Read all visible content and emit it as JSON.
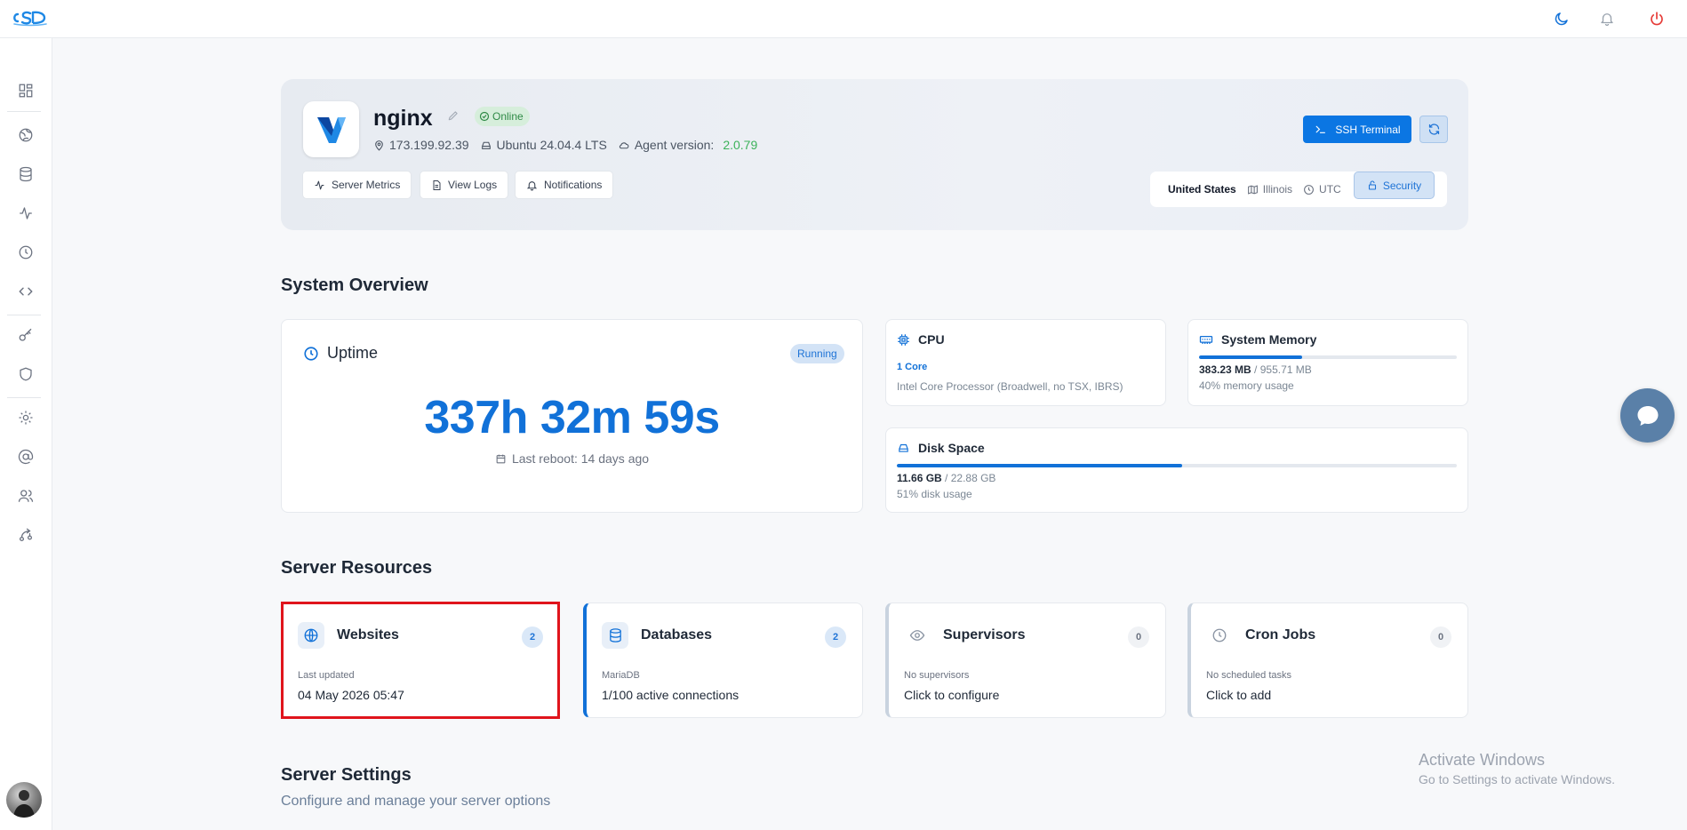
{
  "server": {
    "name": "nginx",
    "status": "Online",
    "ip": "173.199.92.39",
    "os": "Ubuntu 24.04.4 LTS",
    "agent_label": "Agent version:",
    "agent_version": "2.0.79",
    "actions": {
      "metrics": "Server Metrics",
      "logs": "View Logs",
      "notifications": "Notifications",
      "ssh": "SSH Terminal",
      "security": "Security"
    },
    "location": {
      "country": "United States",
      "region": "Illinois",
      "timezone": "UTC"
    }
  },
  "overview": {
    "title": "System Overview",
    "uptime": {
      "label": "Uptime",
      "status": "Running",
      "value": "337h 32m 59s",
      "last_reboot": "Last reboot: 14 days ago"
    },
    "cpu": {
      "label": "CPU",
      "cores": "1 Core",
      "model": "Intel Core Processor (Broadwell, no TSX, IBRS)"
    },
    "memory": {
      "label": "System Memory",
      "used": "383.23 MB",
      "total": "/ 955.71 MB",
      "usage_text": "40% memory usage",
      "usage_fraction": 0.4
    },
    "disk": {
      "label": "Disk Space",
      "used": "11.66 GB",
      "total": "/ 22.88 GB",
      "usage_text": "51% disk usage",
      "usage_fraction": 0.51
    }
  },
  "resources": {
    "title": "Server Resources",
    "items": [
      {
        "label": "Websites",
        "count": "2",
        "sub": "Last updated",
        "value": "04 May 2026 05:47"
      },
      {
        "label": "Databases",
        "count": "2",
        "sub": "MariaDB",
        "value": "1/100 active connections"
      },
      {
        "label": "Supervisors",
        "count": "0",
        "sub": "No supervisors",
        "value": "Click to configure"
      },
      {
        "label": "Cron Jobs",
        "count": "0",
        "sub": "No scheduled tasks",
        "value": "Click to add"
      }
    ]
  },
  "settings": {
    "title": "Server Settings",
    "subtitle": "Configure and manage your server options"
  },
  "watermark": {
    "line1": "Activate Windows",
    "line2": "Go to Settings to activate Windows."
  },
  "colors": {
    "accent": "#1171d8",
    "online": "#2f8a46",
    "power": "#e53935",
    "highlight": "#e0141c"
  },
  "icons": {
    "topbar": [
      "moon-icon",
      "bell-icon",
      "power-icon"
    ],
    "sidebar": [
      "dashboard-icon",
      "globe-icon",
      "database-icon",
      "activity-icon",
      "clock-icon",
      "code-icon",
      "key-icon",
      "shield-icon",
      "gear-icon",
      "at-sign-icon",
      "users-icon",
      "route-icon"
    ]
  }
}
